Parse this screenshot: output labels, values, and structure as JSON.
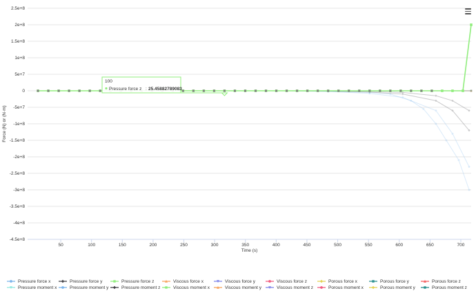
{
  "chart_data": {
    "type": "line",
    "title": "",
    "xlabel": "Time (s)",
    "ylabel": "Force (N) or (N·m)",
    "xlim": [
      5,
      219
    ],
    "ylim": [
      -450000000,
      250000000
    ],
    "x_ticks": [
      50,
      100,
      150,
      200,
      250,
      300,
      350,
      400,
      450,
      500,
      550,
      600,
      650,
      700
    ],
    "x_tick_labels": [
      "50",
      "100",
      "150",
      "200",
      "250",
      "300",
      "350",
      "400",
      "450",
      "500",
      "550",
      "600",
      "650",
      "700"
    ],
    "y_ticks": [
      250000000,
      200000000,
      150000000,
      100000000,
      50000000,
      0,
      -50000000,
      -100000000,
      -150000000,
      -200000000,
      -250000000,
      -300000000,
      -350000000,
      -400000000,
      -450000000
    ],
    "y_tick_labels": [
      "2.5e+8",
      "2e+8",
      "1.5e+8",
      "1e+8",
      "5e+7",
      "0",
      "-5e+7",
      "-1e+8",
      "-1.5e+8",
      "-2e+8",
      "-2.5e+8",
      "-3e+8",
      "-3.5e+8",
      "-4e+8",
      "-4.5e+8"
    ],
    "grid": true,
    "legend_position": "bottom",
    "series": [
      {
        "name": "Pressure force x",
        "color": "#7cb5ec",
        "marker": "circle",
        "faded": true,
        "x": [
          10,
          55,
          70,
          110,
          130,
          150,
          170,
          186,
          202,
          210,
          218
        ],
        "y": [
          0,
          0,
          0,
          0,
          -100000,
          -2000000,
          -8000000,
          -20000000,
          -60000000,
          -130000000,
          -230000000
        ]
      },
      {
        "name": "Pressure force y",
        "color": "#434348",
        "marker": "diamond",
        "faded": true,
        "x": [
          10,
          55,
          70,
          110,
          130,
          150,
          170,
          186,
          202,
          210,
          218
        ],
        "y": [
          0,
          0,
          0,
          0,
          -50000,
          -500000,
          -2000000,
          -5000000,
          -15000000,
          -30000000,
          -60000000
        ]
      },
      {
        "name": "Pressure force z",
        "color": "#90ed7d",
        "marker": "square",
        "faded": false,
        "x": [
          10,
          15,
          20,
          25,
          30,
          35,
          40,
          45,
          50,
          55,
          60,
          65,
          70,
          75,
          80,
          85,
          90,
          95,
          100,
          105,
          110,
          115,
          120,
          125,
          130,
          135,
          140,
          145,
          150,
          155,
          160,
          165,
          170,
          175,
          180,
          185,
          190,
          195,
          200,
          205,
          210,
          215,
          219
        ],
        "y": [
          0,
          0,
          0,
          0,
          0,
          0,
          0,
          0,
          0,
          0,
          0,
          0,
          0,
          0,
          0,
          0,
          0,
          0,
          25.45882789083,
          0,
          0,
          0,
          0,
          0,
          0,
          0,
          0,
          0,
          0,
          0,
          0,
          0,
          0,
          0,
          0,
          0,
          0,
          0,
          0,
          0,
          0,
          0,
          200000000
        ]
      },
      {
        "name": "Viscous force x",
        "color": "#f7a35c",
        "marker": "triangle",
        "faded": true,
        "x": [
          10,
          60,
          110,
          160,
          219
        ],
        "y": [
          0,
          0,
          0,
          0,
          0
        ]
      },
      {
        "name": "Viscous force y",
        "color": "#8085e9",
        "marker": "triangle-down",
        "faded": true,
        "x": [
          10,
          60,
          110,
          160,
          219
        ],
        "y": [
          0,
          0,
          0,
          0,
          0
        ]
      },
      {
        "name": "Viscous force z",
        "color": "#f15c80",
        "marker": "circle",
        "faded": true,
        "x": [
          10,
          60,
          110,
          160,
          219
        ],
        "y": [
          0,
          0,
          0,
          0,
          0
        ]
      },
      {
        "name": "Porous force x",
        "color": "#e4d354",
        "marker": "diamond",
        "faded": true,
        "x": [
          10,
          60,
          110,
          160,
          219
        ],
        "y": [
          0,
          0,
          0,
          0,
          0
        ]
      },
      {
        "name": "Porous force y",
        "color": "#2b908f",
        "marker": "square",
        "faded": true,
        "x": [
          10,
          60,
          110,
          160,
          219
        ],
        "y": [
          0,
          0,
          0,
          0,
          0
        ]
      },
      {
        "name": "Porous force z",
        "color": "#f45b5b",
        "marker": "triangle",
        "faded": true,
        "x": [
          10,
          60,
          110,
          160,
          219
        ],
        "y": [
          0,
          0,
          0,
          0,
          0
        ]
      },
      {
        "name": "Pressure moment x",
        "color": "#91e8e1",
        "marker": "triangle-down",
        "faded": true,
        "x": [
          10,
          60,
          110,
          160,
          219
        ],
        "y": [
          0,
          0,
          0,
          0,
          0
        ]
      },
      {
        "name": "Pressure moment y",
        "color": "#7cb5ec",
        "marker": "circle",
        "faded": true,
        "x": [
          10,
          55,
          70,
          110,
          130,
          150,
          170,
          180,
          190,
          196,
          202,
          207,
          213,
          218
        ],
        "y": [
          0,
          0,
          0,
          0,
          -200000,
          -2000000,
          -5000000,
          -10000000,
          -30000000,
          -55000000,
          -100000000,
          -150000000,
          -210000000,
          -300000000
        ]
      },
      {
        "name": "Pressure moment z",
        "color": "#434348",
        "marker": "diamond",
        "faded": true,
        "x": [
          10,
          55,
          70,
          110,
          130,
          150,
          170,
          186,
          202,
          210,
          218
        ],
        "y": [
          0,
          0,
          0,
          0,
          -80000,
          -1000000,
          -4000000,
          -10000000,
          -30000000,
          -60000000,
          -120000000
        ]
      },
      {
        "name": "Viscous moment x",
        "color": "#90ed7d",
        "marker": "square",
        "faded": true,
        "x": [
          10,
          60,
          110,
          160,
          219
        ],
        "y": [
          0,
          0,
          0,
          0,
          0
        ]
      },
      {
        "name": "Viscous moment y",
        "color": "#f7a35c",
        "marker": "triangle",
        "faded": true,
        "x": [
          10,
          60,
          110,
          160,
          219
        ],
        "y": [
          0,
          0,
          0,
          0,
          0
        ]
      },
      {
        "name": "Viscous moment z",
        "color": "#8085e9",
        "marker": "triangle-down",
        "faded": true,
        "x": [
          10,
          60,
          110,
          160,
          219
        ],
        "y": [
          0,
          0,
          0,
          0,
          0
        ]
      },
      {
        "name": "Porous moment x",
        "color": "#f15c80",
        "marker": "circle",
        "faded": true,
        "x": [
          10,
          60,
          110,
          160,
          219
        ],
        "y": [
          0,
          0,
          0,
          0,
          0
        ]
      },
      {
        "name": "Porous moment y",
        "color": "#e4d354",
        "marker": "diamond",
        "faded": true,
        "x": [
          10,
          60,
          110,
          160,
          219
        ],
        "y": [
          0,
          0,
          0,
          0,
          0
        ]
      },
      {
        "name": "Porous moment z",
        "color": "#2b908f",
        "marker": "square",
        "faded": true,
        "x": [
          10,
          60,
          110,
          160,
          219
        ],
        "y": [
          0,
          0,
          0,
          0,
          0
        ]
      }
    ],
    "tooltip": {
      "header": "100",
      "series_name": "Pressure force z",
      "value": "25.45882789083",
      "color": "#90ed7d"
    }
  },
  "toolbar": {
    "menu_icon": "hamburger-menu-icon"
  }
}
